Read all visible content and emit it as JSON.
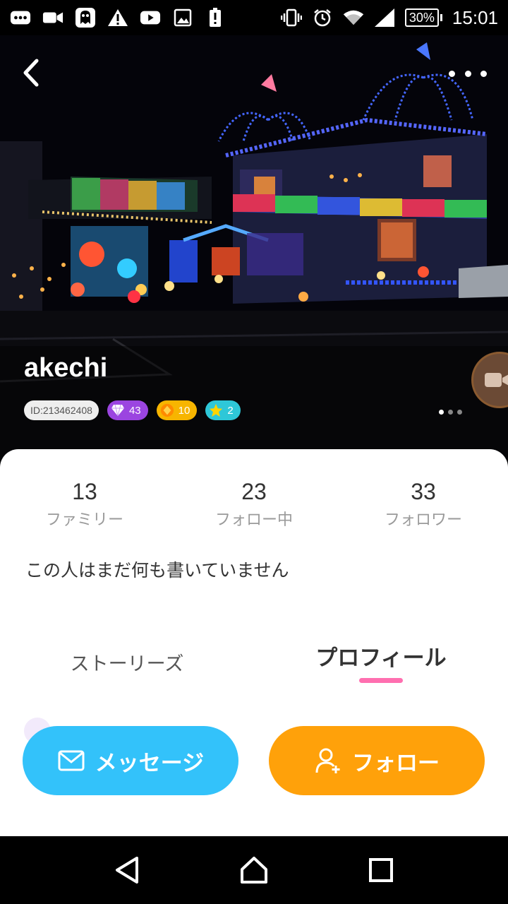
{
  "status_bar": {
    "battery": "30%",
    "time": "15:01",
    "icons": [
      "chat-icon",
      "video-icon",
      "ghost-app-icon",
      "warning-icon",
      "youtube-icon",
      "image-icon",
      "battery-alert-icon",
      "vibrate-icon",
      "alarm-icon",
      "wifi-icon",
      "signal-icon"
    ]
  },
  "profile": {
    "username": "akechi",
    "id_badge": "ID:213462408",
    "diamond_count": "43",
    "coin_count": "10",
    "star_count": "2",
    "photo_pages": 3,
    "active_page": 1
  },
  "stats": [
    {
      "value": "13",
      "label": "ファミリー"
    },
    {
      "value": "23",
      "label": "フォロー中"
    },
    {
      "value": "33",
      "label": "フォロワー"
    }
  ],
  "bio": "この人はまだ何も書いていません",
  "tabs": {
    "stories": "ストーリーズ",
    "profile": "プロフィール",
    "active": "profile"
  },
  "actions": {
    "message": "メッセージ",
    "follow": "フォロー"
  },
  "colors": {
    "message_button": "#33c2fa",
    "follow_button": "#ffa10a",
    "tab_indicator": "#ff6fb0",
    "diamond_badge": "#9b45e0",
    "coin_badge": "#f7b500",
    "star_badge": "#2ec7d8"
  }
}
